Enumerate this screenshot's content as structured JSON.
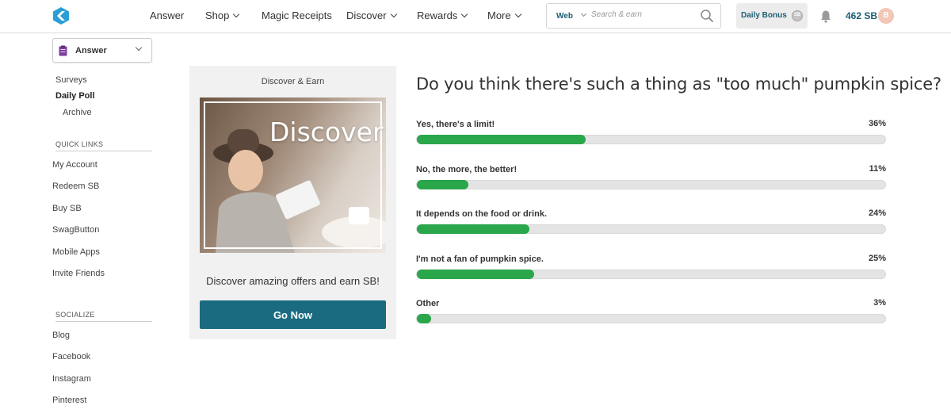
{
  "nav": {
    "items": [
      {
        "label": "Answer",
        "dropdown": false
      },
      {
        "label": "Shop",
        "dropdown": true
      },
      {
        "label": "Magic Receipts",
        "dropdown": false
      },
      {
        "label": "Discover",
        "dropdown": true
      },
      {
        "label": "Rewards",
        "dropdown": true
      },
      {
        "label": "More",
        "dropdown": true
      }
    ],
    "search_scope": "Web",
    "search_placeholder": "Search & earn",
    "daily_bonus": "Daily Bonus",
    "coin_label": "SB",
    "balance": "462 SB",
    "avatar_letter": "B"
  },
  "sidebar": {
    "select_label": "Answer",
    "links": [
      "Surveys",
      "Daily Poll",
      "Archive"
    ],
    "quick_links_heading": "QUICK LINKS",
    "quick_links": [
      "My Account",
      "Redeem SB",
      "Buy SB",
      "SwagButton",
      "Mobile Apps",
      "Invite Friends"
    ],
    "socialize_heading": "SOCIALIZE",
    "socialize": [
      "Blog",
      "Facebook",
      "Instagram",
      "Pinterest"
    ]
  },
  "card": {
    "title": "Discover & Earn",
    "promo_text": "Discover",
    "description": "Discover amazing offers and earn SB!",
    "button": "Go Now"
  },
  "poll": {
    "question": "Do you think there's such a thing as \"too much\" pumpkin spice?",
    "options": [
      {
        "label": "Yes, there's a limit!",
        "percent_text": "36%",
        "percent": 36
      },
      {
        "label": "No, the more, the better!",
        "percent_text": "11%",
        "percent": 11
      },
      {
        "label": "It depends on the food or drink.",
        "percent_text": "24%",
        "percent": 24
      },
      {
        "label": "I'm not a fan of pumpkin spice.",
        "percent_text": "25%",
        "percent": 25
      },
      {
        "label": "Other",
        "percent_text": "3%",
        "percent": 3
      }
    ]
  },
  "colors": {
    "brand": "#1b6b80",
    "bar_fill": "#2aa64b",
    "bar_track": "#e4e4e4"
  }
}
